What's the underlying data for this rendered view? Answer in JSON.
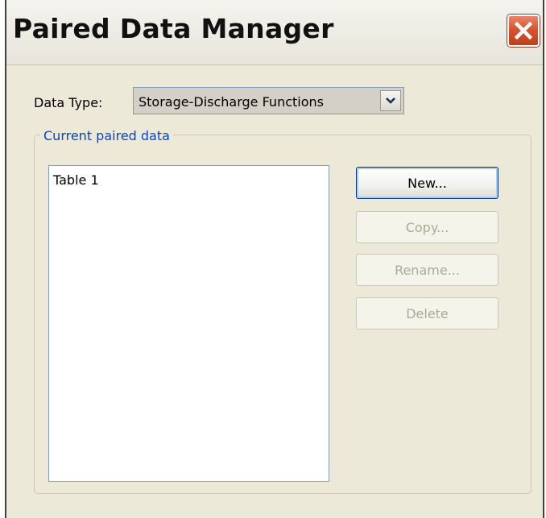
{
  "window": {
    "title": "Paired Data Manager",
    "close_icon": "close-x-icon"
  },
  "data_type": {
    "label": "Data Type:",
    "selected": "Storage-Discharge Functions",
    "arrow_icon": "chevron-down-icon"
  },
  "group": {
    "legend": "Current paired data",
    "items": [
      {
        "label": "Table 1"
      }
    ]
  },
  "buttons": {
    "new": {
      "label": "New...",
      "enabled": true
    },
    "copy": {
      "label": "Copy...",
      "enabled": false
    },
    "rename": {
      "label": "Rename...",
      "enabled": false
    },
    "delete": {
      "label": "Delete",
      "enabled": false
    }
  },
  "colors": {
    "dialog_bg": "#ece9d8",
    "legend_text": "#0046d5",
    "close_button": "#d6542f",
    "disabled_text": "#aca899"
  }
}
